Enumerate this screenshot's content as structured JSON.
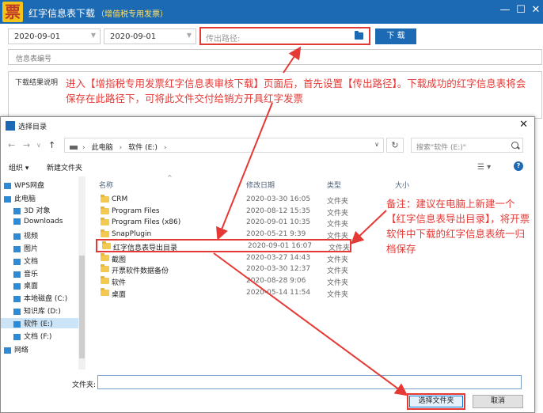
{
  "app": {
    "logo_char": "票",
    "title": "红字信息表下载",
    "subtitle": "（增值税专用发票）",
    "controls": [
      "min",
      "max",
      "close"
    ]
  },
  "toolbar": {
    "start_date": "2020-09-01",
    "end_date": "2020-09-01",
    "path_placeholder": "传出路径:",
    "download_label": "下 载",
    "info_placeholder": "信息表编号",
    "result_label": "下载结果说明"
  },
  "callouts": {
    "main": "进入【增指税专用发票红字信息表审核下载】页面后，首先设置【传出路径】。下载成功的红字信息表将会保存在此路径下，可将此文件交付给销方开具红字发票",
    "note": "备注：建议在电脑上新建一个【红字信息表导出目录】，将开票软件中下载的红字信息表统一归档保存"
  },
  "dialog": {
    "title": "选择目录",
    "breadcrumbs": [
      "此电脑",
      "软件 (E:)"
    ],
    "search_placeholder": "搜索\"软件 (E:)\"",
    "organize_label": "组织 ▾",
    "new_folder_label": "新建文件夹",
    "columns": {
      "name": "名称",
      "date": "修改日期",
      "type": "类型",
      "size": "大小"
    },
    "nav_items": [
      {
        "label": "WPS网盘",
        "selected": false
      },
      {
        "label": "此电脑",
        "selected": false
      },
      {
        "label": "3D 对象",
        "selected": false
      },
      {
        "label": "Downloads",
        "selected": false
      },
      {
        "label": "视频",
        "selected": false
      },
      {
        "label": "图片",
        "selected": false
      },
      {
        "label": "文档",
        "selected": false
      },
      {
        "label": "音乐",
        "selected": false
      },
      {
        "label": "桌面",
        "selected": false
      },
      {
        "label": "本地磁盘 (C:)",
        "selected": false
      },
      {
        "label": "知识库 (D:)",
        "selected": false
      },
      {
        "label": "软件 (E:)",
        "selected": true
      },
      {
        "label": "文档 (F:)",
        "selected": false
      },
      {
        "label": "网络",
        "selected": false
      }
    ],
    "files": [
      {
        "name": "CRM",
        "date": "2020-03-30 16:05",
        "type": "文件夹",
        "highlight": false
      },
      {
        "name": "Program Files",
        "date": "2020-08-12 15:35",
        "type": "文件夹",
        "highlight": false
      },
      {
        "name": "Program Files (x86)",
        "date": "2020-09-01 10:35",
        "type": "文件夹",
        "highlight": false
      },
      {
        "name": "SnapPlugin",
        "date": "2020-05-21 9:39",
        "type": "文件夹",
        "highlight": false
      },
      {
        "name": "红字信息表导出目录",
        "date": "2020-09-01 16:07",
        "type": "文件夹",
        "highlight": true
      },
      {
        "name": "截图",
        "date": "2020-03-27 14:43",
        "type": "文件夹",
        "highlight": false
      },
      {
        "name": "开票软件数据备份",
        "date": "2020-03-30 12:37",
        "type": "文件夹",
        "highlight": false
      },
      {
        "name": "软件",
        "date": "2020-08-28 9:06",
        "type": "文件夹",
        "highlight": false
      },
      {
        "name": "桌面",
        "date": "2020-05-14 11:54",
        "type": "文件夹",
        "highlight": false
      }
    ],
    "folder_label": "文件夹:",
    "folder_value": "",
    "select_label": "选择文件夹",
    "cancel_label": "取消"
  },
  "colors": {
    "brand_blue": "#1b6ab3",
    "annotation_red": "#e53935"
  }
}
